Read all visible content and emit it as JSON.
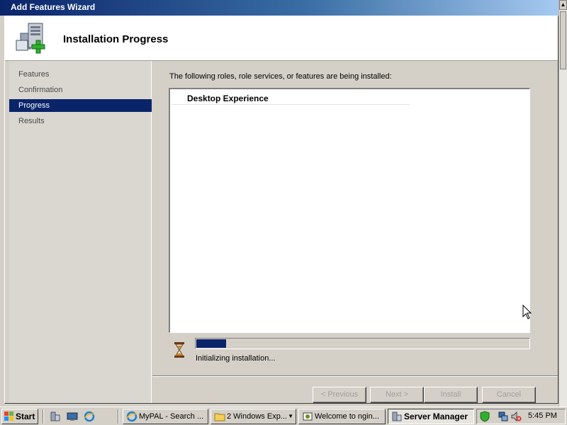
{
  "window": {
    "title": "Add Features Wizard"
  },
  "header": {
    "title": "Installation Progress",
    "icon": "server-add-icon"
  },
  "nav": {
    "items": [
      {
        "label": "Features",
        "active": false
      },
      {
        "label": "Confirmation",
        "active": false
      },
      {
        "label": "Progress",
        "active": true
      },
      {
        "label": "Results",
        "active": false
      }
    ]
  },
  "content": {
    "description": "The following roles, role services, or features are being installed:",
    "items": [
      "Desktop Experience"
    ],
    "progress_percent": 9,
    "status": "Initializing installation..."
  },
  "buttons": {
    "previous": "< Previous",
    "next": "Next >",
    "install": "Install",
    "cancel": "Cancel"
  },
  "taskbar": {
    "start": "Start",
    "tasks": [
      {
        "label": "MyPAL - Search ...",
        "icon": "browser-icon"
      },
      {
        "label": "2 Windows Exp...",
        "icon": "folder-icon"
      },
      {
        "label": "Welcome to ngin...",
        "icon": "web-page-icon"
      },
      {
        "label": "Server Manager",
        "icon": "server-manager-icon",
        "active": true
      }
    ],
    "clock": "5:45 PM"
  },
  "colors": {
    "accent": "#0a246a",
    "face": "#d4d0c8"
  }
}
